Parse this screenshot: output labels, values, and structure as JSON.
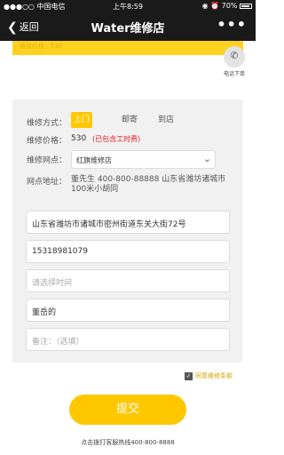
{
  "statusbar": {
    "carrier": "●●●○○ 中国电信",
    "wifi": "≋",
    "time": "上午8:59",
    "icons": "◉ ⏰",
    "battery": "70%"
  },
  "nav": {
    "back_label": "返回",
    "back_icon": "chevron-left",
    "title": "Water维修店",
    "more": "•••"
  },
  "banner": {
    "text": "维修价格：530"
  },
  "phone_order": {
    "label": "电话下单",
    "icon": "phone-icon"
  },
  "form": {
    "method_label": "维修方式：",
    "methods": [
      "上门",
      "邮寄",
      "到店"
    ],
    "selected_method": "上门",
    "price_label": "维修价格：",
    "price_value": "530",
    "price_note": "(已包含工时费)",
    "store_label": "维修网点：",
    "store_value": "红旗维修店",
    "address_label": "网点地址：",
    "address_text": "董先生 400-800-88888 山东省潍坊诸城市100米小胡同",
    "user_address": "山东省潍坊市诸城市密州街道东关大街72号",
    "phone": "15318981079",
    "time_placeholder": "请选择时间",
    "name": "董岳的",
    "note_placeholder": "备注：（选填）"
  },
  "agreement": {
    "label": "同意维修条款",
    "checked": true
  },
  "submit_label": "提交",
  "hotline": "点击拨打客服热线400-800-8888",
  "colors": {
    "accent": "#ffc700",
    "nav_bg": "#1a1a1a",
    "price_note": "#e02020"
  }
}
